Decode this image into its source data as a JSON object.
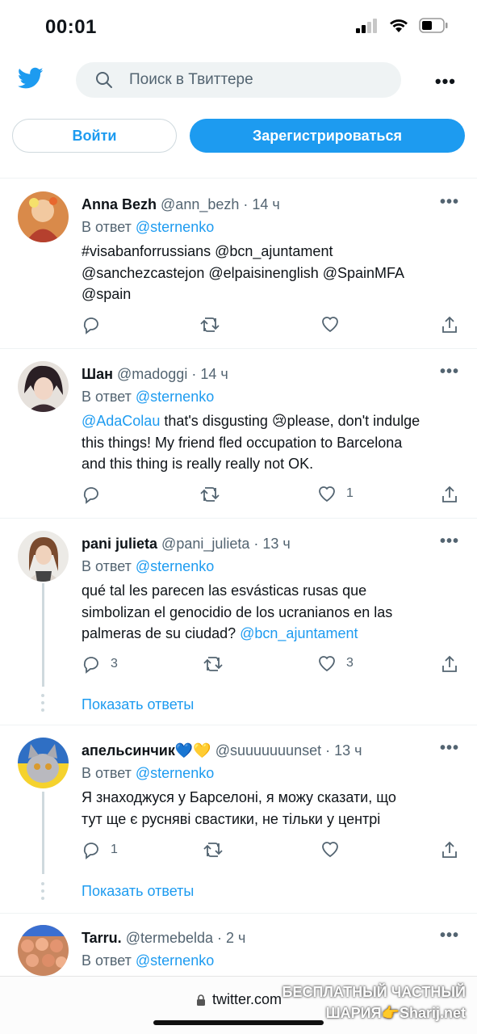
{
  "status": {
    "time": "00:01"
  },
  "search": {
    "placeholder": "Поиск в Твиттере"
  },
  "auth": {
    "login": "Войти",
    "signup": "Зарегистрироваться"
  },
  "tweets": [
    {
      "name": "Anna Bezh",
      "handle": "@ann_bezh · 14 ч",
      "reply_prefix": "В ответ ",
      "reply_to": "@sternenko",
      "lines": [
        "#visabanforrussians @bcn_ajuntament",
        "@sanchezcastejon @elpaisinenglish @SpainMFA",
        "@spain"
      ],
      "replies": "",
      "retweets": "",
      "likes": ""
    },
    {
      "name": "Шан",
      "handle": "@madoggi · 14 ч",
      "reply_prefix": "В ответ ",
      "reply_to": "@sternenko",
      "mention": "@AdaColau",
      "line1_rest": " that's disgusting 😢please, don't indulge",
      "line2": "this things! My friend fled occupation to Barcelona",
      "line3": "and this thing is really really not OK.",
      "replies": "",
      "retweets": "",
      "likes": "1"
    },
    {
      "name": "pani julieta",
      "handle": "@pani_julieta · 13 ч",
      "reply_prefix": "В ответ ",
      "reply_to": "@sternenko",
      "line1": "qué tal les parecen las esvásticas rusas que",
      "line2": "simbolizan el genocidio de los ucranianos en las",
      "line3_text": "palmeras de su ciudad? ",
      "line3_mention": "@bcn_ajuntament",
      "replies": "3",
      "retweets": "",
      "likes": "3",
      "show_replies": "Показать ответы"
    },
    {
      "name": "апельсинчик💙💛",
      "handle": "@suuuuuuunset · 13 ч",
      "reply_prefix": "В ответ ",
      "reply_to": "@sternenko",
      "line1": "Я знаходжуся у Барселоні, я можу сказати, що",
      "line2": "тут ще є русняві свастики, не тільки у центрі",
      "replies": "1",
      "retweets": "",
      "likes": "",
      "show_replies": "Показать ответы"
    },
    {
      "name": "Tarru.",
      "handle": "@termebelda · 2 ч",
      "reply_prefix": "В ответ ",
      "reply_to": "@sternenko"
    }
  ],
  "browser": {
    "url": "twitter.com"
  },
  "watermark": {
    "line1": "БЕСПЛАТНЫЙ ЧАСТНЫЙ",
    "line2": "ШАРИЯ👉Sharij.net"
  },
  "colors": {
    "accent": "#1d9bf0",
    "secondary_text": "#536471"
  }
}
